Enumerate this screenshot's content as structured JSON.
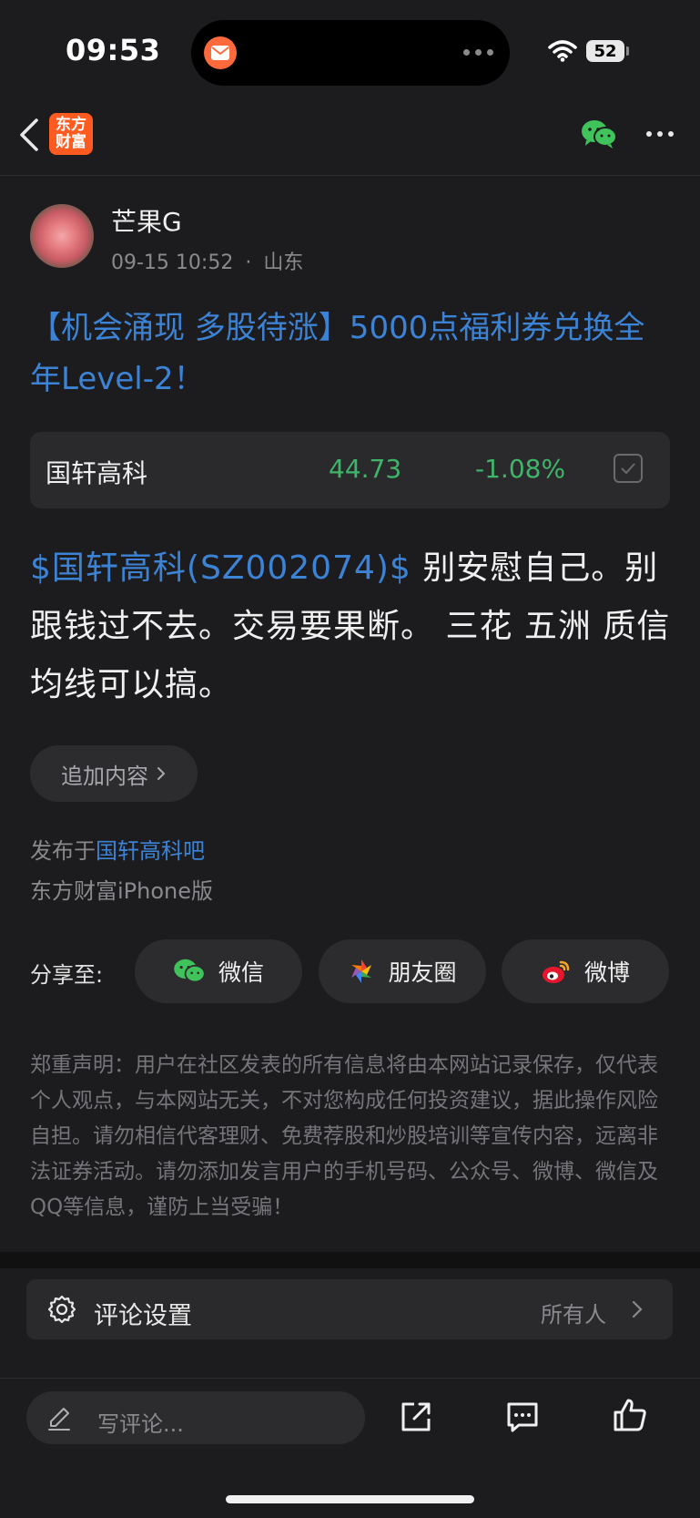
{
  "status_bar": {
    "time": "09:53",
    "battery": "52"
  },
  "nav": {
    "logo_text": "东方\n财富"
  },
  "post": {
    "author": "芒果G",
    "timestamp": "09-15 10:52",
    "separator": "·",
    "location": "山东",
    "title": "【机会涌现 多股待涨】5000点福利券兑换全年Level-2！",
    "stock": {
      "name": "国轩高科",
      "price": "44.73",
      "change": "-1.08%"
    },
    "content_link": "$国轩高科(SZ002074)$",
    "content_text": " 别安慰自己。别跟钱过不去。交易要果断。 三花 五洲 质信 均线可以搞。",
    "add_content_label": "追加内容",
    "posted_prefix": "发布于",
    "posted_bar": "国轩高科吧",
    "device": "东方财富iPhone版"
  },
  "share": {
    "label": "分享至:",
    "wechat": "微信",
    "moments": "朋友圈",
    "weibo": "微博"
  },
  "disclaimer": "郑重声明：用户在社区发表的所有信息将由本网站记录保存，仅代表个人观点，与本网站无关，不对您构成任何投资建议，据此操作风险自担。请勿相信代客理财、免费荐股和炒股培训等宣传内容，远离非法证券活动。请勿添加发言用户的手机号码、公众号、微博、微信及QQ等信息，谨防上当受骗！",
  "comment_settings": {
    "label": "评论设置",
    "value": "所有人"
  },
  "bottom_bar": {
    "placeholder": "写评论..."
  },
  "colors": {
    "accent_blue": "#3c83d6",
    "stock_green": "#3fb56a",
    "logo_orange": "#ff5a1f"
  }
}
